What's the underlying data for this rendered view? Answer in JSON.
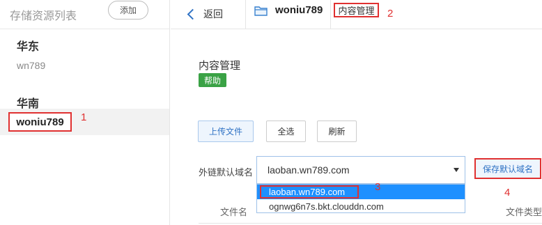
{
  "sidebar": {
    "title": "存储资源列表",
    "add_label": "添加",
    "regions": [
      {
        "name": "华东",
        "buckets": [
          "wn789"
        ]
      },
      {
        "name": "华南",
        "buckets": [
          "woniu789"
        ]
      }
    ],
    "annotation": "1"
  },
  "topbar": {
    "back_label": "返回",
    "bucket_name": "woniu789",
    "tab_label": "内容管理",
    "annotation": "2"
  },
  "main": {
    "title": "内容管理",
    "help_label": "帮助",
    "buttons": {
      "upload": "上传文件",
      "select_all": "全选",
      "refresh": "刷新"
    },
    "domain_label": "外链默认域名",
    "domain_value": "laoban.wn789.com",
    "save_label": "保存默认域名",
    "dropdown_options": [
      "laoban.wn789.com",
      "ognwg6n7s.bkt.clouddn.com"
    ],
    "annotation_dropdown": "3",
    "annotation_save": "4",
    "columns": {
      "filename": "文件名",
      "filetype": "文件类型"
    }
  },
  "colors": {
    "annotation_red": "#e03030",
    "accent_blue": "#2f72c4",
    "help_green": "#3aa245",
    "selected_blue": "#1e90ff"
  },
  "icons": {
    "back": "chevron-left-icon",
    "bucket": "folder-icon",
    "select": "caret-down-icon"
  }
}
